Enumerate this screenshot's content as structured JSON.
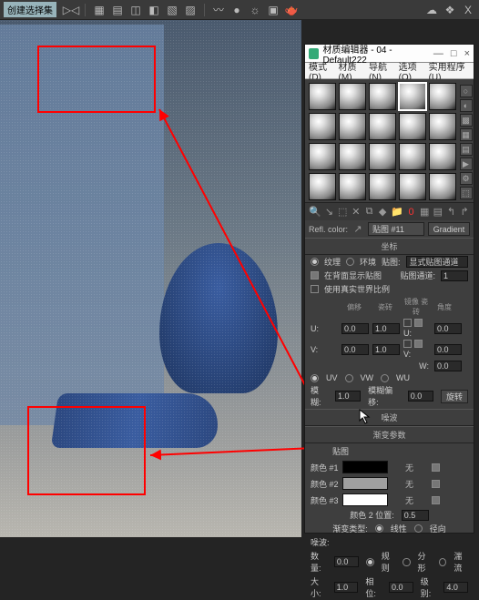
{
  "toolbar": {
    "label": "创建选择集",
    "right_x": "X"
  },
  "material_editor": {
    "title": "材质编辑器 - 04 - Default222",
    "minimize": "—",
    "restore": "□",
    "close": "×",
    "menu": {
      "mode": "模式(D)",
      "material": "材质(M)",
      "navigate": "导航(N)",
      "options": "选项(O)",
      "utilities": "实用程序(U)"
    },
    "refl_label": "Refl. color:",
    "slot_name": "贴图 #11",
    "type_button": "Gradient",
    "sections": {
      "coords": "坐标",
      "noise": "噪波",
      "gradient_params": "渐变参数"
    },
    "coords": {
      "texture": "纹理",
      "environment": "环境",
      "mapping_label": "贴图:",
      "mapping_value": "显式贴图通道",
      "show_in_back": "在背面显示贴图",
      "channel_label": "贴图通道:",
      "channel_value": "1",
      "use_real_world": "使用真实世界比例",
      "col_offset": "偏移",
      "col_tiling": "瓷砖",
      "col_mirror": "镜像",
      "col_tile": "瓷砖",
      "col_angle": "角度",
      "u_label": "U:",
      "v_label": "V:",
      "w_label": "W:",
      "u_off": "0.0",
      "u_tile": "1.0",
      "u_ang": "0.0",
      "v_off": "0.0",
      "v_tile": "1.0",
      "v_ang": "0.0",
      "w_ang": "0.0",
      "uv": "UV",
      "vw": "VW",
      "wu": "WU",
      "blur_label": "模糊:",
      "blur_value": "1.0",
      "blur_off_label": "模糊偏移:",
      "blur_off_value": "0.0",
      "rotate_btn": "旋转"
    },
    "gradient": {
      "color1_label": "颜色 #1",
      "color2_label": "颜色 #2",
      "color3_label": "颜色 #3",
      "none": "无",
      "pos2_label": "颜色 2 位置:",
      "pos2_value": "0.5",
      "type_label": "渐变类型:",
      "type_linear": "线性",
      "type_radial": "径向"
    },
    "noise_params": {
      "header": "噪波:",
      "amount_label": "数量:",
      "amount_value": "0.0",
      "regular": "规则",
      "fractal": "分形",
      "turb": "湍流",
      "size_label": "大小:",
      "size_value": "1.0",
      "phase_label": "相位:",
      "phase_value": "0.0",
      "levels_label": "级别:",
      "levels_value": "4.0"
    }
  }
}
